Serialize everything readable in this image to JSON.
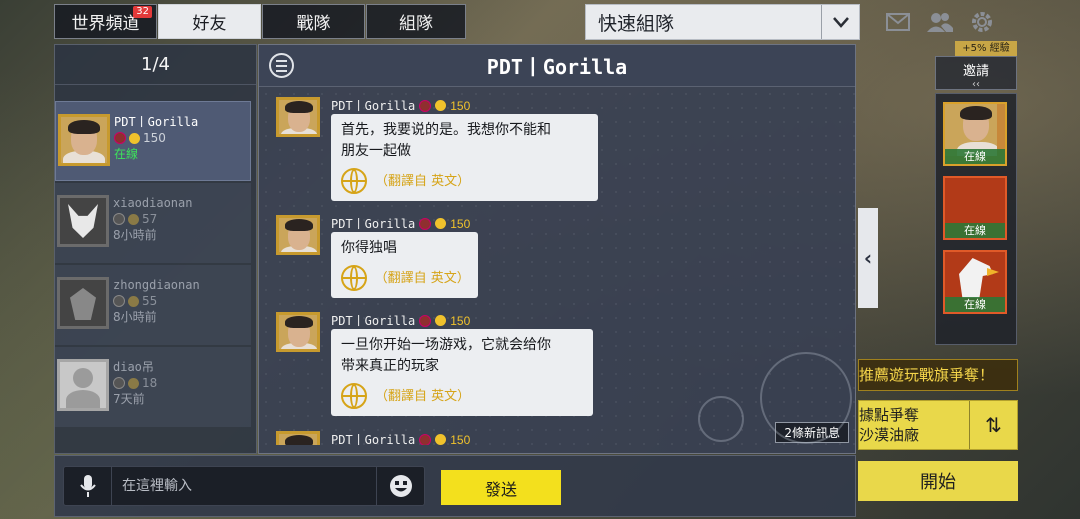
{
  "tabs": [
    {
      "label": "世界頻道",
      "badge": "32"
    },
    {
      "label": "好友",
      "active": true
    },
    {
      "label": "戰隊"
    },
    {
      "label": "組隊"
    }
  ],
  "quick_team": {
    "label": "快速組隊"
  },
  "friends": {
    "count": "1/4",
    "items": [
      {
        "name": "PDT丨Gorilla",
        "level": "150",
        "status": "在線"
      },
      {
        "name": "xiaodiaonan",
        "level": "57",
        "status": "8小時前"
      },
      {
        "name": "zhongdiaonan",
        "level": "55",
        "status": "8小時前"
      },
      {
        "name": "diao吊",
        "level": "18",
        "status": "7天前"
      }
    ]
  },
  "chat": {
    "title": "PDT丨Gorilla",
    "messages": [
      {
        "sender": "PDT丨Gorilla",
        "level": "150",
        "line1": "首先，我要说的是。我想你不能和",
        "line2": "朋友一起做",
        "translate": "（翻譯自 英文）"
      },
      {
        "sender": "PDT丨Gorilla",
        "level": "150",
        "line1": "你得独唱",
        "line2": "",
        "translate": "（翻譯自 英文）"
      },
      {
        "sender": "PDT丨Gorilla",
        "level": "150",
        "line1": "一旦你开始一场游戏，它就会给你",
        "line2": "带来真正的玩家",
        "translate": "（翻譯自 英文）"
      },
      {
        "sender": "PDT丨Gorilla",
        "level": "150"
      }
    ],
    "new_messages": "2條新訊息"
  },
  "input": {
    "placeholder": "在這裡輸入",
    "send_label": "發送"
  },
  "side": {
    "exp_badge": "+5% 經驗",
    "invite_label": "邀請",
    "slot_status": "在線",
    "promo": "推薦遊玩戰旗爭奪！",
    "mode_line1": "據點爭奪",
    "mode_line2": "沙漠油廠",
    "start_label": "開始"
  },
  "colors": {
    "accent_yellow": "#f3e01d",
    "online_green": "#3de35b",
    "gold_level": "#f0c22c",
    "translate_gold": "#d6a418"
  }
}
